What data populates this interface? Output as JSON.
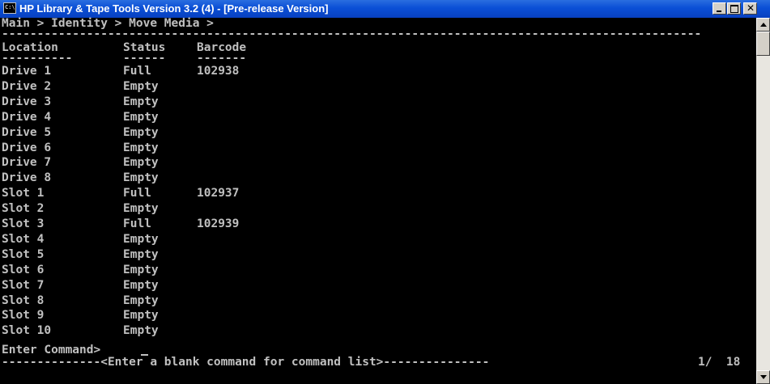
{
  "window": {
    "title": "HP Library & Tape Tools Version 3.2 (4) - [Pre-release Version]",
    "app_icon": "C:\\",
    "icon": "console-icon",
    "controls": {
      "minimize": "minimize-icon",
      "maximize": "maximize-icon",
      "close": "close-icon"
    }
  },
  "console": {
    "breadcrumb": "Main > Identity > Move Media >",
    "separator_top": "---------------------------------------------------------------------------------------------------",
    "headers": {
      "location": "Location",
      "status": "Status",
      "barcode": "Barcode"
    },
    "underlines": {
      "location": "----------",
      "status": "------",
      "barcode": "-------"
    },
    "rows": [
      {
        "location": "Drive 1",
        "status": "Full",
        "barcode": "102938"
      },
      {
        "location": "Drive 2",
        "status": "Empty",
        "barcode": ""
      },
      {
        "location": "Drive 3",
        "status": "Empty",
        "barcode": ""
      },
      {
        "location": "Drive 4",
        "status": "Empty",
        "barcode": ""
      },
      {
        "location": "Drive 5",
        "status": "Empty",
        "barcode": ""
      },
      {
        "location": "Drive 6",
        "status": "Empty",
        "barcode": ""
      },
      {
        "location": "Drive 7",
        "status": "Empty",
        "barcode": ""
      },
      {
        "location": "Drive 8",
        "status": "Empty",
        "barcode": ""
      },
      {
        "location": "Slot 1",
        "status": "Full",
        "barcode": "102937"
      },
      {
        "location": "Slot 2",
        "status": "Empty",
        "barcode": ""
      },
      {
        "location": "Slot 3",
        "status": "Full",
        "barcode": "102939"
      },
      {
        "location": "Slot 4",
        "status": "Empty",
        "barcode": ""
      },
      {
        "location": "Slot 5",
        "status": "Empty",
        "barcode": ""
      },
      {
        "location": "Slot 6",
        "status": "Empty",
        "barcode": ""
      },
      {
        "location": "Slot 7",
        "status": "Empty",
        "barcode": ""
      },
      {
        "location": "Slot 8",
        "status": "Empty",
        "barcode": ""
      },
      {
        "location": "Slot 9",
        "status": "Empty",
        "barcode": ""
      },
      {
        "location": "Slot 10",
        "status": "Empty",
        "barcode": ""
      }
    ],
    "prompt": "Enter Command>",
    "footer": "--------------<Enter a blank command for command list>---------------",
    "page_indicator": "1/  18"
  },
  "scrollbar": {
    "up": "scroll-up-arrow-icon",
    "down": "scroll-down-arrow-icon"
  },
  "colors": {
    "titlebar": "#0a4fd6",
    "console_bg": "#000000",
    "console_fg": "#c0c0c0"
  }
}
